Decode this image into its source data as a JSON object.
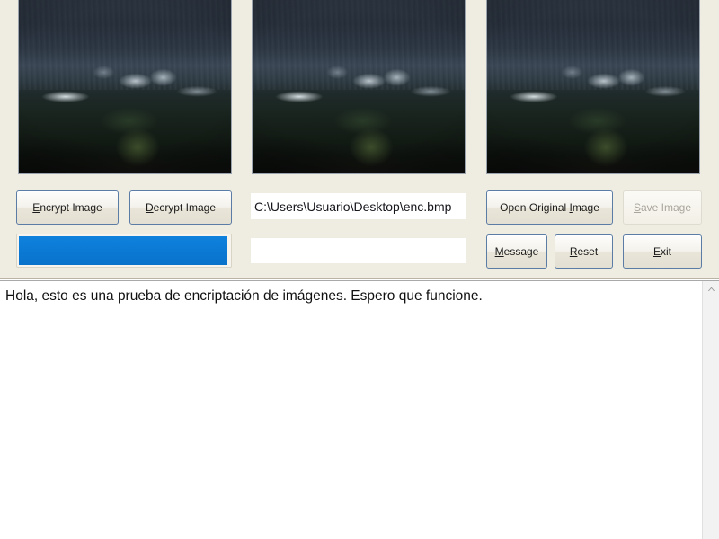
{
  "app": {
    "background_color": "#efece1",
    "accent_color": "#0a79d4"
  },
  "images": {
    "alt_original": "stormy-mountain-valley-photo",
    "panels": [
      {
        "name": "original-image-preview"
      },
      {
        "name": "encrypted-image-preview"
      },
      {
        "name": "decrypted-image-preview"
      }
    ]
  },
  "buttons": {
    "encrypt": {
      "label": "Encrypt Image",
      "accel": "E",
      "enabled": true
    },
    "decrypt": {
      "label": "Decrypt Image",
      "accel": "D",
      "enabled": true
    },
    "open_original": {
      "label": "Open Original Image",
      "accel": "I",
      "enabled": true
    },
    "save": {
      "label": "Save Image",
      "accel": "S",
      "enabled": false
    },
    "message": {
      "label": "Message",
      "accel": "M",
      "enabled": true
    },
    "reset": {
      "label": "Reset",
      "accel": "R",
      "enabled": true
    },
    "exit": {
      "label": "Exit",
      "accel": "E",
      "enabled": true
    }
  },
  "fields": {
    "path": {
      "value": "C:\\Users\\Usuario\\Desktop\\enc.bmp",
      "placeholder": ""
    },
    "message": {
      "value": "",
      "placeholder": ""
    }
  },
  "progress": {
    "percent": 99,
    "fill_color": "#0a79d4"
  },
  "output": {
    "text": "Hola, esto es una prueba de encriptación de imágenes. Espero que funcione."
  },
  "scrollbar": {
    "up_arrow_icon": "chevron-up-icon"
  }
}
